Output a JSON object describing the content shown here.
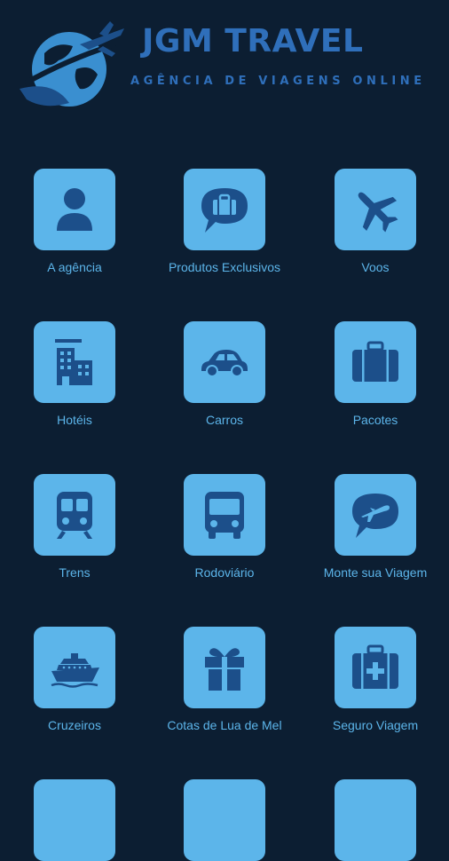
{
  "brand": {
    "title": "JGM TRAVEL",
    "subtitle": "AGÊNCIA DE VIAGENS ONLINE",
    "logo_icon": "globe-airplane-icon"
  },
  "colors": {
    "background": "#0c1e32",
    "tile": "#5cb5ea",
    "icon": "#1c4f8a",
    "brand": "#2f6fba"
  },
  "menu": [
    {
      "label": "A agência",
      "icon": "person-icon"
    },
    {
      "label": "Produtos Exclusivos",
      "icon": "briefcase-chat-icon"
    },
    {
      "label": "Voos",
      "icon": "airplane-icon"
    },
    {
      "label": "Hotéis",
      "icon": "hotel-icon"
    },
    {
      "label": "Carros",
      "icon": "car-icon"
    },
    {
      "label": "Pacotes",
      "icon": "suitcase-icon"
    },
    {
      "label": "Trens",
      "icon": "train-icon"
    },
    {
      "label": "Rodoviário",
      "icon": "bus-icon"
    },
    {
      "label": "Monte sua Viagem",
      "icon": "plane-chat-icon"
    },
    {
      "label": "Cruzeiros",
      "icon": "ship-icon"
    },
    {
      "label": "Cotas de Lua de Mel",
      "icon": "gift-icon"
    },
    {
      "label": "Seguro Viagem",
      "icon": "medical-kit-icon"
    }
  ]
}
